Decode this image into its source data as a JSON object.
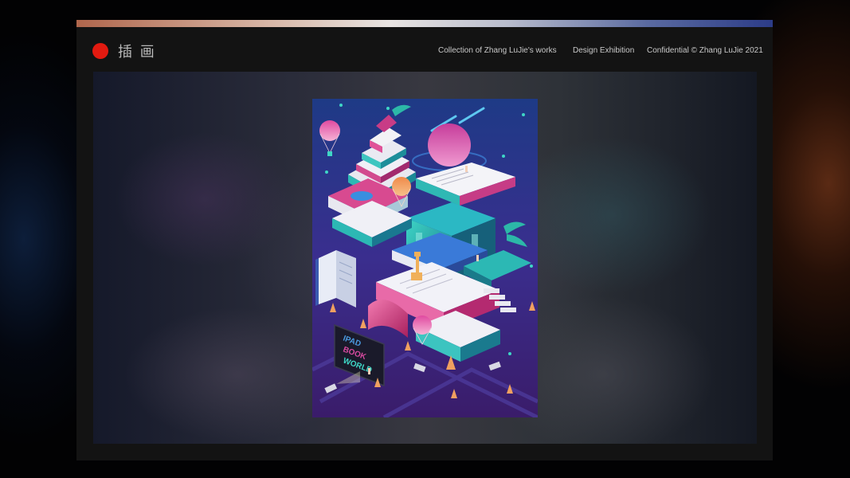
{
  "header": {
    "logo_text": "插 画",
    "nav": [
      "Collection of Zhang LuJie's works",
      "Design Exhibition",
      "Confidential © Zhang LuJie 2021"
    ]
  },
  "artwork": {
    "tablet_text": [
      "IPAD",
      "BOOK",
      "WORLD"
    ]
  },
  "colors": {
    "accent_dot": "#e21a10",
    "frame_background": "#131313",
    "artwork_background": "#3a2a78"
  }
}
